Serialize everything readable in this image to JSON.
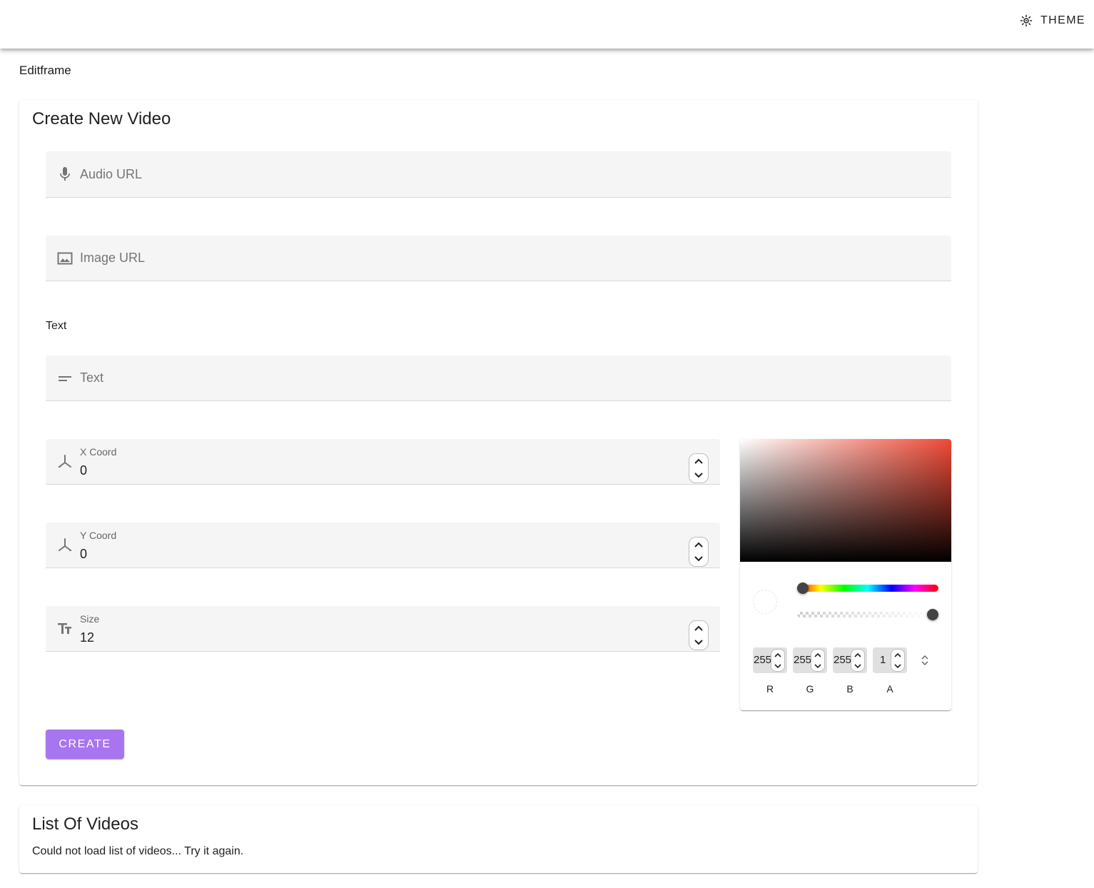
{
  "header": {
    "theme_label": "THEME"
  },
  "brand": "Editframe",
  "create_card": {
    "title": "Create New Video",
    "audio_placeholder": "Audio URL",
    "image_placeholder": "Image URL",
    "text_section_label": "Text",
    "text_placeholder": "Text",
    "x_coord": {
      "label": "X Coord",
      "value": "0"
    },
    "y_coord": {
      "label": "Y Coord",
      "value": "0"
    },
    "size": {
      "label": "Size",
      "value": "12"
    },
    "create_label": "CREATE"
  },
  "color_picker": {
    "hue_color": "#f04a36",
    "hue_level": 0,
    "alpha_level": 1,
    "channels": [
      {
        "label": "R",
        "value": "255"
      },
      {
        "label": "G",
        "value": "255"
      },
      {
        "label": "B",
        "value": "255"
      },
      {
        "label": "A",
        "value": "1"
      }
    ]
  },
  "list_card": {
    "title": "List Of Videos",
    "message": "Could not load list of videos... Try it again."
  },
  "colors": {
    "accent": "#a875f0",
    "field_bg": "#f5f5f5",
    "icon": "#757575"
  }
}
